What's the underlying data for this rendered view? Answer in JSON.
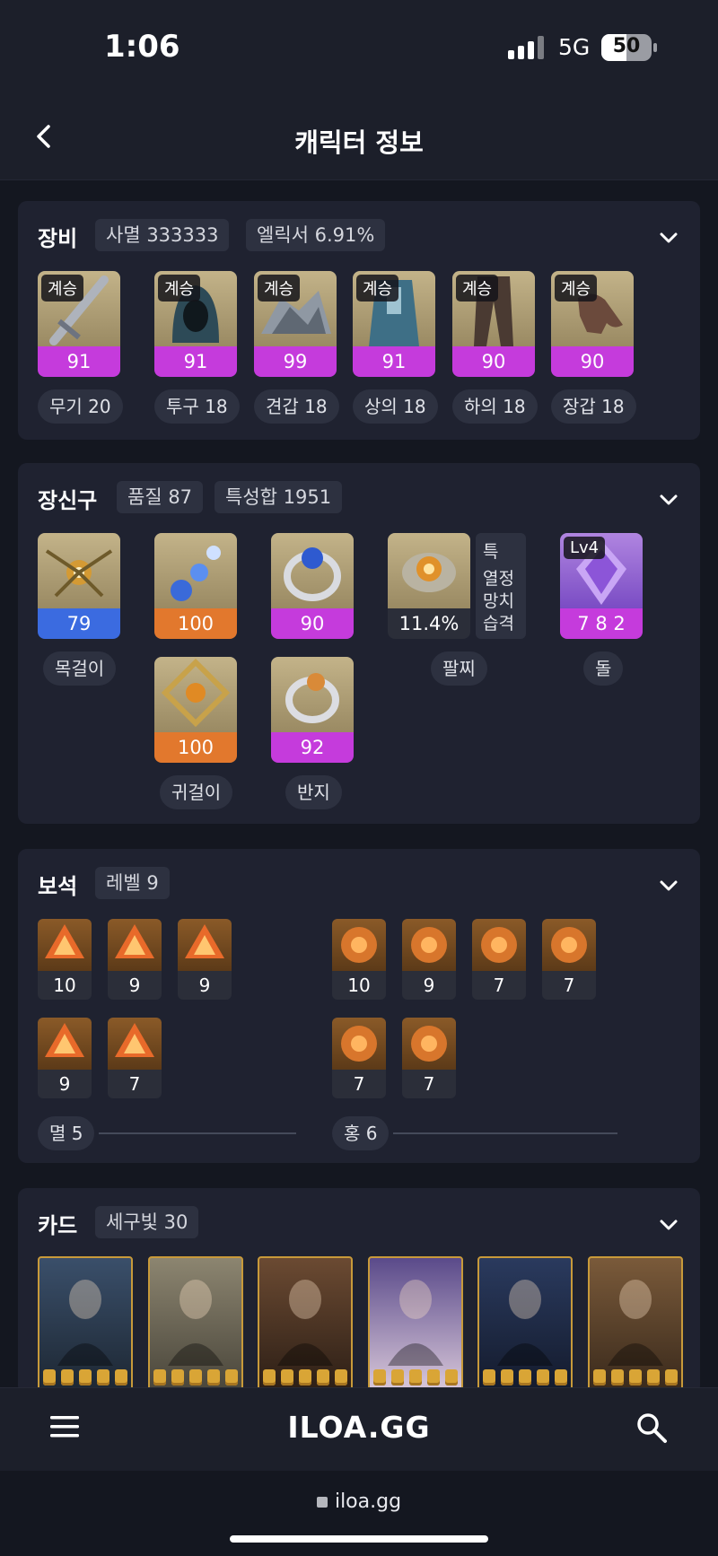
{
  "status": {
    "time": "1:06",
    "network": "5G",
    "battery": "50",
    "battery_level": 0.5
  },
  "header": {
    "title": "캐릭터 정보",
    "back_icon": "chevron-left-icon"
  },
  "equipment": {
    "title": "장비",
    "chips": [
      "사멸 333333",
      "엘릭서 6.91%"
    ],
    "items": [
      {
        "tag": "계승",
        "value": "91",
        "label": "무기 20"
      },
      {
        "tag": "계승",
        "value": "91",
        "label": "투구 18"
      },
      {
        "tag": "계승",
        "value": "99",
        "label": "견갑 18"
      },
      {
        "tag": "계승",
        "value": "91",
        "label": "상의 18"
      },
      {
        "tag": "계승",
        "value": "90",
        "label": "하의 18"
      },
      {
        "tag": "계승",
        "value": "90",
        "label": "장갑 18"
      }
    ]
  },
  "accessories": {
    "title": "장신구",
    "chips": [
      "품질 87",
      "특성합 1951"
    ],
    "necklace": {
      "value": "79",
      "label": "목걸이",
      "color": "#3b6be0"
    },
    "earrings": [
      {
        "value": "100",
        "color": "#e2782d"
      },
      {
        "value": "100",
        "color": "#e2782d"
      }
    ],
    "earring_label": "귀걸이",
    "rings": [
      {
        "value": "90",
        "color": "#c53bdc"
      },
      {
        "value": "92",
        "color": "#c53bdc"
      }
    ],
    "ring_label": "반지",
    "bracelet": {
      "value": "11.4%",
      "label": "팔찌",
      "stats": [
        "특",
        "열정",
        "망치",
        "습격"
      ]
    },
    "stone": {
      "tag": "Lv4",
      "value": "7 8 2",
      "label": "돌"
    }
  },
  "gems": {
    "title": "보석",
    "chips": [
      "레벨 9"
    ],
    "left_row1": [
      "10",
      "9",
      "9"
    ],
    "left_row2": [
      "9",
      "7"
    ],
    "right_row1": [
      "10",
      "9",
      "7",
      "7"
    ],
    "right_row2": [
      "7",
      "7"
    ],
    "left_label": "멸 5",
    "right_label": "홍 6"
  },
  "cards": {
    "title": "카드",
    "chips": [
      "세구빛 30"
    ],
    "count": 6
  },
  "nav": {
    "logo": "ILOA.GG",
    "menu_icon": "hamburger-menu-icon",
    "search_icon": "search-icon"
  },
  "browser": {
    "url": "iloa.gg"
  }
}
